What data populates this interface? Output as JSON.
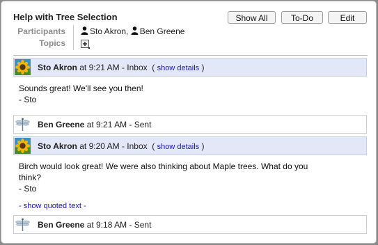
{
  "thread": {
    "title": "Help with Tree Selection",
    "buttons": {
      "show_all": "Show All",
      "todo": "To-Do",
      "edit": "Edit"
    },
    "participants_label": "Participants",
    "topics_label": "Topics",
    "participants": [
      "Sto Akron,",
      "Ben Greene"
    ]
  },
  "messages": [
    {
      "sender": "Sto Akron",
      "meta": "at 9:21 AM  -  Inbox",
      "link_open": "( ",
      "link": "show details",
      "link_close": " )",
      "body": "Sounds great!  We'll see you then!\n- Sto"
    },
    {
      "sender": "Ben Greene",
      "meta": "at 9:21 AM  -  Sent"
    },
    {
      "sender": "Sto Akron",
      "meta": "at 9:20 AM  -  Inbox",
      "link_open": "( ",
      "link": "show details",
      "link_close": " )",
      "body": "Birch would look great!  We were also thinking about Maple trees.  What do you\nthink?\n- Sto",
      "quoted": "- show quoted text -"
    },
    {
      "sender": "Ben Greene",
      "meta": "at 9:18 AM  -  Sent"
    }
  ],
  "icons": {
    "participant": "person-icon",
    "topic_add": "add-topic-icon",
    "avatar_sto": "sunflower-avatar-icon",
    "avatar_ben": "dragonfly-icon"
  },
  "colors": {
    "inbox_header_bg": "#e2e8f7",
    "link": "#1a1aa6",
    "label_gray": "#8c8c8c"
  }
}
